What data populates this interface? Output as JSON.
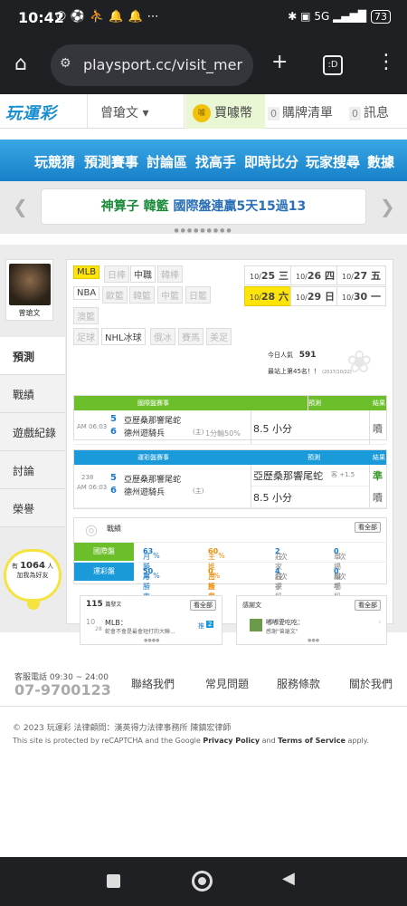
{
  "status": {
    "time": "10:42",
    "battery": "73",
    "signal": "5G"
  },
  "browser": {
    "url": "playsport.cc/visit_mer",
    "tab_label": ":D"
  },
  "site": {
    "logo": "玩運彩",
    "username": "曾瑲文",
    "coins_label": "買噱幣",
    "coin_icon_text": "噱",
    "cart_count": "0",
    "cart_label": "購牌清單",
    "msg_count": "0",
    "msg_label": "訊息"
  },
  "nav": [
    "玩競猜",
    "預測賽事",
    "討論區",
    "找高手",
    "即時比分",
    "玩家搜尋",
    "數據"
  ],
  "banner": {
    "part1": "神算子",
    "part2": "韓籃",
    "part3": "國際盤連贏5天15過13"
  },
  "profile": {
    "name": "曾瑲文"
  },
  "sidetabs": [
    "預測",
    "戰績",
    "遊戲紀錄",
    "討論",
    "榮譽"
  ],
  "online": {
    "prefix": "有",
    "count": "1064",
    "suffix": "人",
    "line2": "加我為好友"
  },
  "sports": [
    {
      "label": "MLB",
      "state": "sel"
    },
    {
      "label": "日棒",
      "state": "off"
    },
    {
      "label": "中職",
      "state": "on"
    },
    {
      "label": "韓棒",
      "state": "off"
    },
    {
      "label": "NBA",
      "state": "on"
    },
    {
      "label": "歐籃",
      "state": "off"
    },
    {
      "label": "韓籃",
      "state": "off"
    },
    {
      "label": "中籃",
      "state": "off"
    },
    {
      "label": "日籃",
      "state": "off"
    },
    {
      "label": "澳籃",
      "state": "off"
    },
    {
      "label": "足球",
      "state": "off"
    },
    {
      "label": "NHL冰球",
      "state": "on"
    },
    {
      "label": "俄冰",
      "state": "off"
    },
    {
      "label": "賽馬",
      "state": "off"
    },
    {
      "label": "美足",
      "state": "off"
    }
  ],
  "dates": [
    {
      "md": "10/",
      "d": "25",
      "w": "三"
    },
    {
      "md": "10/",
      "d": "26",
      "w": "四"
    },
    {
      "md": "10/",
      "d": "27",
      "w": "五"
    },
    {
      "md": "10/",
      "d": "28",
      "w": "六"
    },
    {
      "md": "10/",
      "d": "29",
      "w": "日"
    },
    {
      "md": "10/",
      "d": "30",
      "w": "一"
    }
  ],
  "rank": {
    "today_label": "今日人氣",
    "today_value": "591",
    "best_label": "最站上第45名！！",
    "best_date": "(2017/10/22)"
  },
  "intl": {
    "header": "國際盤賽事",
    "pred_header": "預測",
    "result_header": "結果",
    "time": "AM 06:03",
    "team1_no": "5",
    "team1": "亞歷桑那響尾蛇",
    "team2_no": "6",
    "team2": "德州遊騎兵",
    "team2_tag": "(主)",
    "line": "1分輸50%",
    "pick": "8.5 小分",
    "result": "𡂝"
  },
  "tw": {
    "header": "運彩盤賽事",
    "pred_header": "預測",
    "result_header": "結果",
    "game_no": "238",
    "time": "AM 06:03",
    "team1_no": "5",
    "team1": "亞歷桑那響尾蛇",
    "team2_no": "6",
    "team2": "德州遊騎兵",
    "team2_tag": "(主)",
    "pick1": "亞歷桑那響尾蛇",
    "pick1_tag": "客 +1.5",
    "result1": "準",
    "pick2": "8.5 小分",
    "result2": "𡂝"
  },
  "stats": {
    "title": "戰績",
    "see_all": "看全部",
    "rows": [
      {
        "tag": "國際盤",
        "m1": "月勝率",
        "v1": "63",
        "u1": "%",
        "m2": "主推月勝率",
        "v2": "60",
        "u2": "%",
        "m3": "莊家殺手",
        "v3": "2",
        "u3": "次",
        "m4": "單場殺手",
        "v4": "0",
        "u4": "次"
      },
      {
        "tag": "運彩盤",
        "m1": "月勝率",
        "v1": "50",
        "u1": "%",
        "m2": "主推月勝率",
        "v2": "0",
        "u2": "%",
        "m3": "莊家殺手",
        "v3": "4",
        "u3": "次",
        "m4": "單場殺手",
        "v4": "0",
        "u4": "次"
      }
    ]
  },
  "posts": {
    "count": "115",
    "label": "篇發文",
    "see_all": "看全部",
    "month": "10",
    "day": "28",
    "board": "MLB：",
    "snippet": "蛇會不會是最會短打的大聯...",
    "badge_label": "推",
    "badge": "2"
  },
  "thanks": {
    "label": "感謝文",
    "see_all": "看全部",
    "title": "嘟嘟愛吃吃：",
    "snippet": "感謝\"曾瑲文\""
  },
  "footer": {
    "phone_label": "客服電話 09:30 ~ 24:00",
    "phone": "07-9700123",
    "links": [
      "聯絡我們",
      "常見問題",
      "服務條款",
      "關於我們"
    ],
    "copyright": "© 2023 玩運彩 法律顧問：漢英得力法律事務所 陳鎮宏律師",
    "recaptcha_pre": "This site is protected by reCAPTCHA and the Google",
    "privacy": "Privacy Policy",
    "and": "and",
    "terms": "Terms of Service",
    "apply": "apply."
  },
  "colors": {
    "accent_blue": "#1a9ad9",
    "accent_green": "#6cbf2a",
    "highlight": "#ffe40a"
  }
}
